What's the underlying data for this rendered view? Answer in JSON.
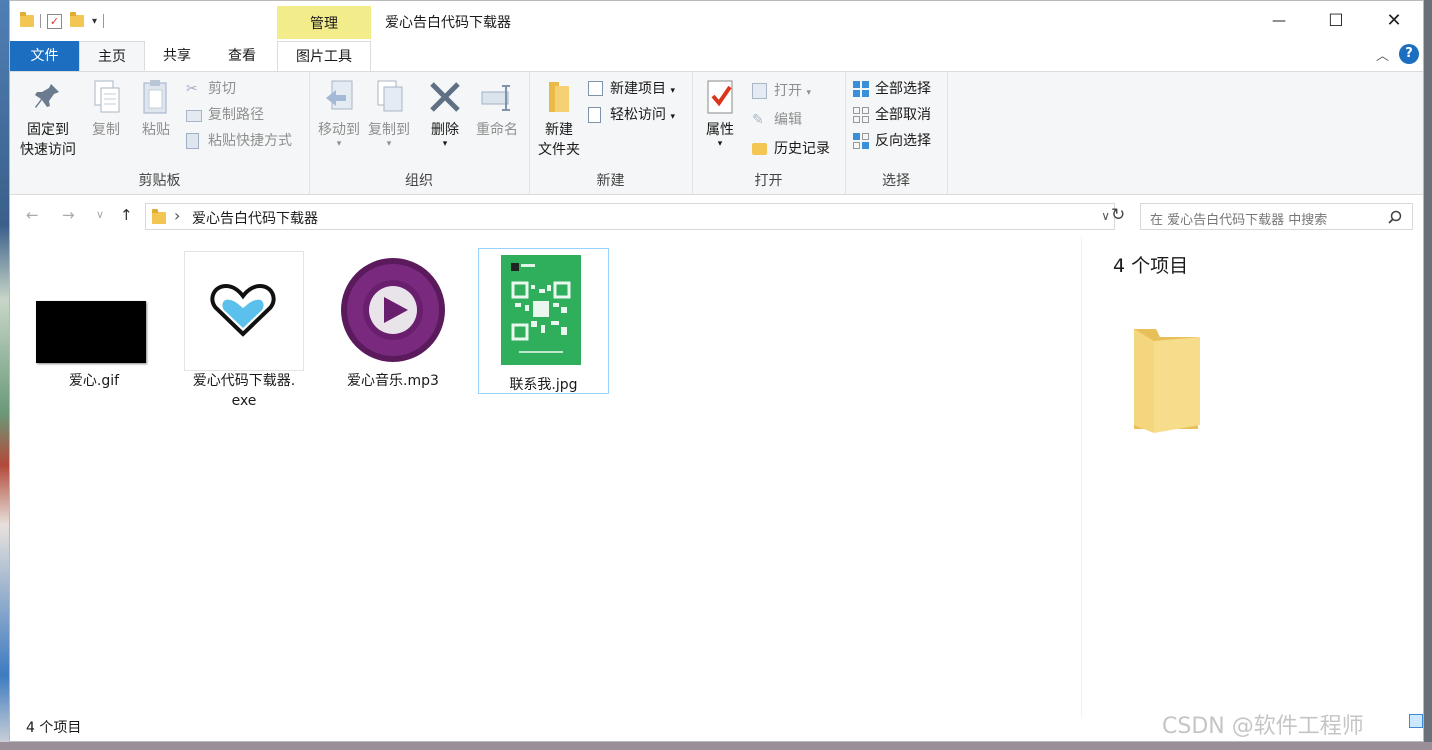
{
  "window": {
    "title": "爱心告白代码下载器",
    "manage_tab": "管理"
  },
  "window_controls": {
    "minimize": "—",
    "maximize": "☐",
    "close": "✕"
  },
  "tabs": {
    "file": "文件",
    "home": "主页",
    "share": "共享",
    "view": "查看",
    "picture_tools": "图片工具"
  },
  "help": "?",
  "ribbon": {
    "clipboard": {
      "label": "剪贴板",
      "pin_line1": "固定到",
      "pin_line2": "快速访问",
      "copy": "复制",
      "paste": "粘贴",
      "cut": "剪切",
      "copy_path": "复制路径",
      "paste_shortcut": "粘贴快捷方式"
    },
    "organize": {
      "label": "组织",
      "move_to": "移动到",
      "copy_to": "复制到",
      "delete": "删除",
      "rename": "重命名"
    },
    "new": {
      "label": "新建",
      "new_folder_line1": "新建",
      "new_folder_line2": "文件夹",
      "new_item": "新建项目",
      "easy_access": "轻松访问"
    },
    "open": {
      "label": "打开",
      "properties": "属性",
      "open": "打开",
      "edit": "编辑",
      "history": "历史记录"
    },
    "select": {
      "label": "选择",
      "select_all": "全部选择",
      "select_none": "全部取消",
      "invert": "反向选择"
    }
  },
  "nav": {
    "back": "←",
    "forward": "→",
    "recent": "∨",
    "up": "↑",
    "chevron": "›",
    "refresh": "↻",
    "dropdown": "∨"
  },
  "address": {
    "path": "爱心告白代码下载器"
  },
  "search": {
    "placeholder": "在 爱心告白代码下载器 中搜索"
  },
  "files": [
    {
      "name": "爱心.gif",
      "type": "gif"
    },
    {
      "name_line1": "爱心代码下载器.",
      "name_line2": "exe",
      "type": "exe"
    },
    {
      "name": "爱心音乐.mp3",
      "type": "mp3"
    },
    {
      "name": "联系我.jpg",
      "type": "jpg",
      "selected": true
    }
  ],
  "details": {
    "title": "4 个项目"
  },
  "status": {
    "count": "4 个项目"
  },
  "watermark": "CSDN @软件工程师",
  "colors": {
    "accent": "#1c6fc0",
    "manage_tab": "#f3ec8a",
    "selection": "#cce8ff"
  }
}
